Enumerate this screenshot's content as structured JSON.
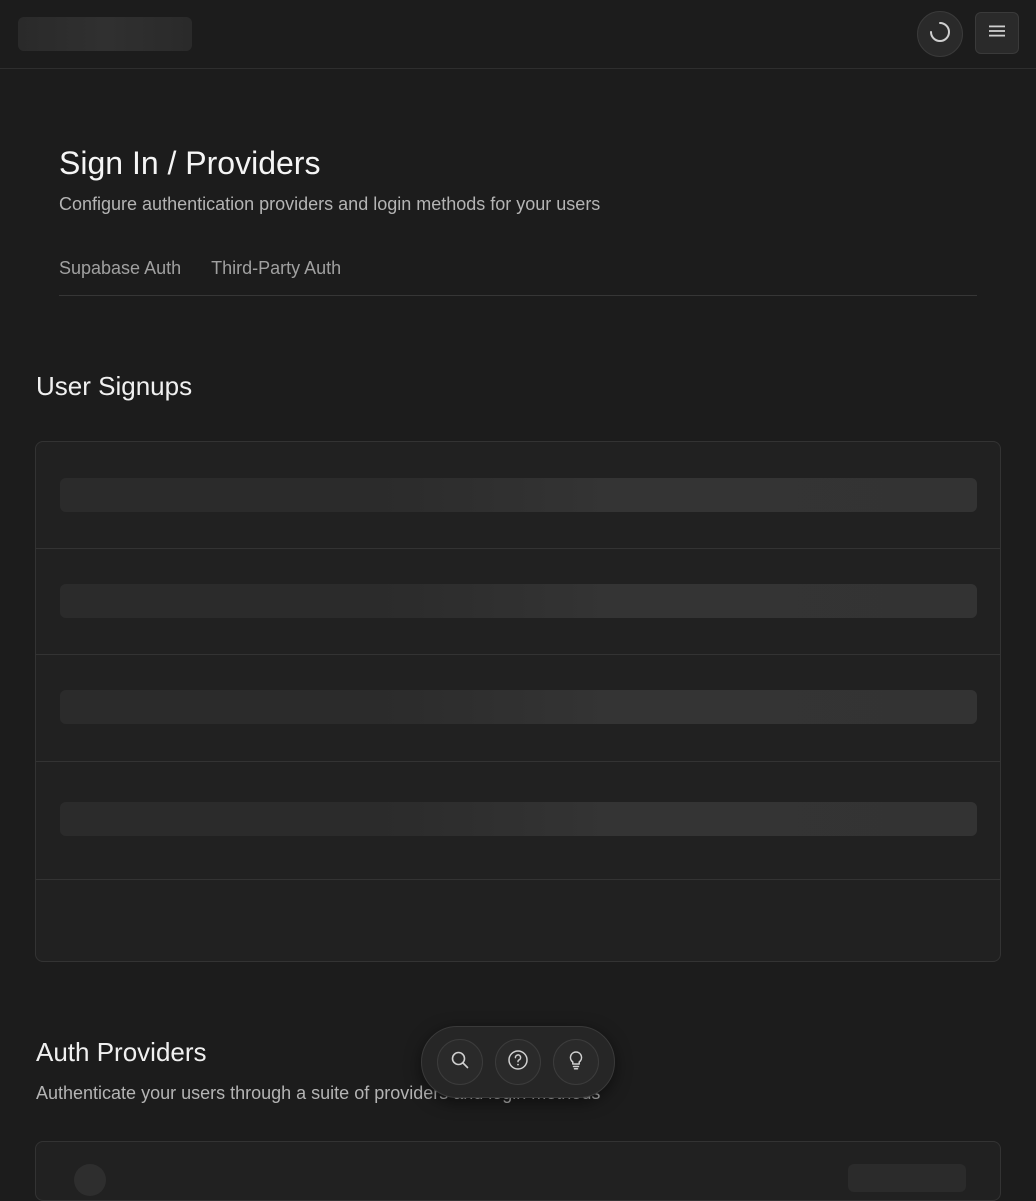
{
  "header": {
    "logo_icon": "skeleton-placeholder",
    "loading_icon": "spinner-icon",
    "menu_icon": "hamburger-menu-icon"
  },
  "page": {
    "title": "Sign In / Providers",
    "subtitle": "Configure authentication providers and login methods for your users"
  },
  "tabs": [
    {
      "label": "Supabase Auth"
    },
    {
      "label": "Third-Party Auth"
    }
  ],
  "user_signups": {
    "title": "User Signups",
    "loading_rows": 4
  },
  "auth_providers": {
    "title": "Auth Providers",
    "description": "Authenticate your users through a suite of providers and login methods"
  },
  "floating_toolbar": {
    "buttons": [
      {
        "icon": "search-icon"
      },
      {
        "icon": "help-icon"
      },
      {
        "icon": "lightbulb-icon"
      }
    ]
  },
  "colors": {
    "background": "#1c1c1c",
    "card": "#212121",
    "border": "#333333",
    "text_primary": "#ededed",
    "text_secondary": "#b4b4b4"
  }
}
